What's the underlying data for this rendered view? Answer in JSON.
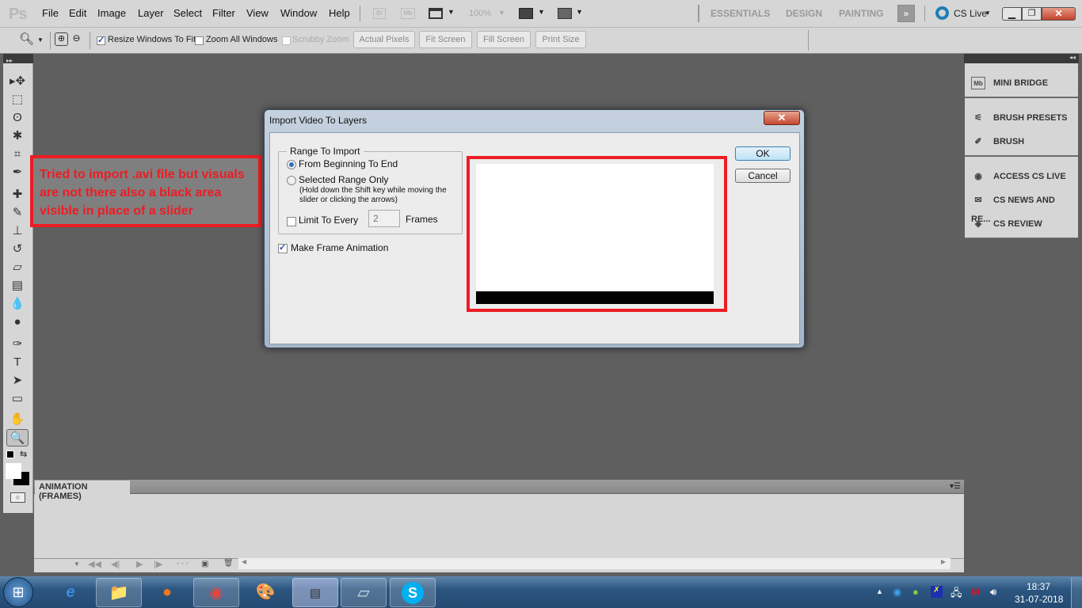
{
  "app": {
    "logo": "Ps"
  },
  "menu": [
    "File",
    "Edit",
    "Image",
    "Layer",
    "Select",
    "Filter",
    "View",
    "Window",
    "Help"
  ],
  "appbar": {
    "bridge": "Br",
    "minibridge": "Mb",
    "zoom_level": "100%"
  },
  "workspaces": [
    "ESSENTIALS",
    "DESIGN",
    "PAINTING"
  ],
  "more_workspaces": "»",
  "cs_live": "CS Live",
  "options": {
    "resize_windows": {
      "label": "Resize Windows To Fit",
      "checked": true
    },
    "zoom_all": {
      "label": "Zoom All Windows",
      "checked": false
    },
    "scrubby": {
      "label": "Scrubby Zoom",
      "checked": false
    },
    "buttons": [
      "Actual Pixels",
      "Fit Screen",
      "Fill Screen",
      "Print Size"
    ]
  },
  "tools": [
    {
      "name": "move-tool-icon",
      "glyph": "▸✥"
    },
    {
      "name": "marquee-tool-icon",
      "glyph": "⬚"
    },
    {
      "name": "lasso-tool-icon",
      "glyph": "ʘ"
    },
    {
      "name": "magic-wand-tool-icon",
      "glyph": "✱"
    },
    {
      "name": "crop-tool-icon",
      "glyph": "⌗"
    },
    {
      "name": "eyedropper-tool-icon",
      "glyph": "✒"
    },
    {
      "name": "healing-brush-tool-icon",
      "glyph": "✚"
    },
    {
      "name": "brush-tool-icon",
      "glyph": "✎"
    },
    {
      "name": "clone-stamp-tool-icon",
      "glyph": "⊥"
    },
    {
      "name": "history-brush-tool-icon",
      "glyph": "↺"
    },
    {
      "name": "eraser-tool-icon",
      "glyph": "▱"
    },
    {
      "name": "gradient-tool-icon",
      "glyph": "▤"
    },
    {
      "name": "blur-tool-icon",
      "glyph": "💧"
    },
    {
      "name": "dodge-tool-icon",
      "glyph": "●"
    },
    {
      "name": "pen-tool-icon",
      "glyph": "✑"
    },
    {
      "name": "type-tool-icon",
      "glyph": "T"
    },
    {
      "name": "path-selection-tool-icon",
      "glyph": "➤"
    },
    {
      "name": "shape-tool-icon",
      "glyph": "▭"
    },
    {
      "name": "hand-tool-icon",
      "glyph": "✋"
    },
    {
      "name": "zoom-tool-icon",
      "glyph": "🔍"
    }
  ],
  "right_panel": {
    "groups": [
      [
        {
          "label": "MINI BRIDGE",
          "icon": "Mb"
        }
      ],
      [
        {
          "label": "BRUSH PRESETS",
          "icon": "⚟"
        },
        {
          "label": "BRUSH",
          "icon": "✐"
        }
      ],
      [
        {
          "label": "ACCESS CS LIVE",
          "icon": "◉"
        },
        {
          "label": "CS NEWS AND RE...",
          "icon": "✉"
        },
        {
          "label": "CS REVIEW",
          "icon": "◈"
        }
      ]
    ]
  },
  "annotation": "Tried to import .avi file but visuals are not there also a black area visible in place of a slider",
  "dialog": {
    "title": "Import Video To Layers",
    "close": "✕",
    "range_legend": "Range To Import",
    "opt_full": "From Beginning To End",
    "opt_range": "Selected Range Only",
    "range_hint": "(Hold down the Shift key while moving the slider or clicking the arrows)",
    "limit_label": "Limit To Every",
    "limit_value": "2",
    "frames_label": "Frames",
    "make_anim": "Make Frame Animation",
    "ok": "OK",
    "cancel": "Cancel",
    "selected_option": "From Beginning To End",
    "limit_checked": false,
    "make_anim_checked": true
  },
  "animation_panel": {
    "tab": "ANIMATION (FRAMES)"
  },
  "taskbar": {
    "apps": [
      "start",
      "internet-explorer",
      "file-explorer",
      "firefox",
      "chrome",
      "paint",
      "active-window",
      "notepad",
      "skype"
    ],
    "time": "18:37",
    "date": "31-07-2018"
  }
}
